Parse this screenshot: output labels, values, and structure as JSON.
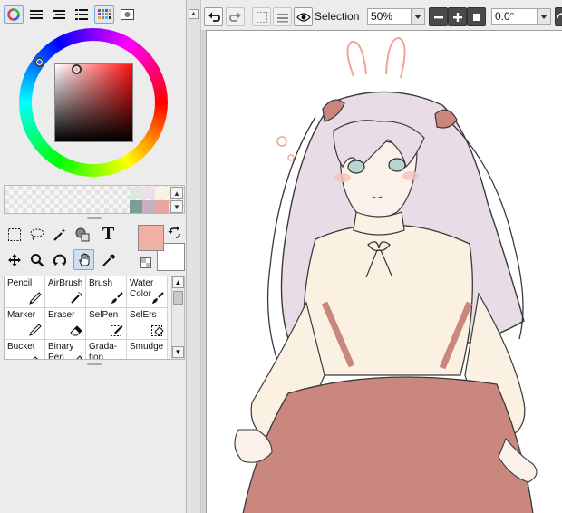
{
  "colors": {
    "primary": "#f0b0a5",
    "secondary": "#ffffff",
    "accent": "#7aa7d8"
  },
  "color_tabs": [
    {
      "icon": "color-wheel-icon"
    },
    {
      "icon": "rgb-sliders-icon"
    },
    {
      "icon": "hsv-sliders-icon"
    },
    {
      "icon": "swatch-list-icon"
    },
    {
      "icon": "swatch-grid-icon"
    },
    {
      "icon": "scratchpad-icon"
    }
  ],
  "swatches": [
    "#dfe7e3",
    "#ecdfe7",
    "#fbf2e2",
    "#7d9d98",
    "#c6b0bf",
    "#e8a79e"
  ],
  "tools": [
    {
      "icon": "rect-select-icon"
    },
    {
      "icon": "lasso-icon"
    },
    {
      "icon": "magic-wand-icon"
    },
    {
      "icon": "eyedropper-shapes-icon"
    },
    {
      "icon": "text-icon",
      "glyph": "T"
    },
    {
      "icon": "move-icon"
    },
    {
      "icon": "zoom-icon"
    },
    {
      "icon": "rotate-icon"
    },
    {
      "icon": "hand-icon"
    },
    {
      "icon": "eyedropper-icon"
    }
  ],
  "brushes": [
    {
      "label": "Pencil"
    },
    {
      "label": "AirBrush"
    },
    {
      "label": "Brush"
    },
    {
      "label": "Water Color"
    },
    {
      "label": "Marker"
    },
    {
      "label": "Eraser"
    },
    {
      "label": "SelPen"
    },
    {
      "label": "SelErs"
    },
    {
      "label": "Bucket"
    },
    {
      "label": "Binary Pen"
    },
    {
      "label": "Grada-tion"
    },
    {
      "label": "Smudge"
    }
  ],
  "toolbar": {
    "selection_label": "Selection",
    "zoom": "50%",
    "rotation": "0.0°"
  }
}
